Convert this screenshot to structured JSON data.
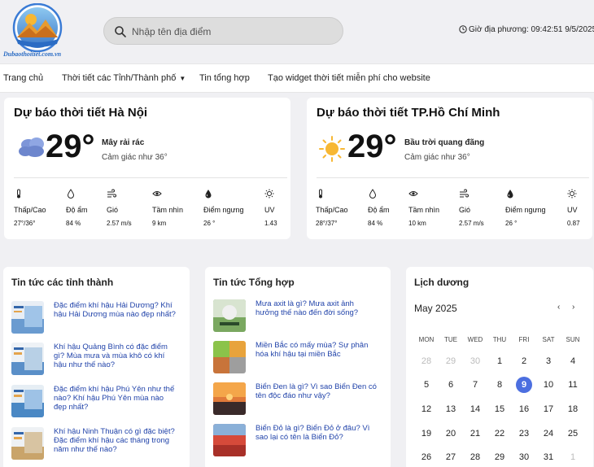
{
  "header": {
    "logo_text": "Dubaothoitiet.com.vn",
    "search_placeholder": "Nhập tên địa điểm",
    "clock_label": "Giờ địa phương: 09:42:51 9/5/2025"
  },
  "nav": {
    "items": [
      {
        "label": "Trang chủ"
      },
      {
        "label": "Thời tiết các Tỉnh/Thành phố"
      },
      {
        "label": "Tin tổng hợp"
      },
      {
        "label": "Tạo widget thời tiết miễn phí cho website"
      }
    ]
  },
  "weather": [
    {
      "title": "Dự báo thời tiết Hà Nội",
      "temp": "29°",
      "condition": "Mây rải rác",
      "feels": "Cảm giác như 36°",
      "icon": "cloud-icon",
      "stats": [
        {
          "icon": "thermometer-icon",
          "label": "Thấp/Cao",
          "value": "27°/36°"
        },
        {
          "icon": "droplet-icon",
          "label": "Độ ẩm",
          "value": "84 %"
        },
        {
          "icon": "wind-icon",
          "label": "Gió",
          "value": "2.57 m/s"
        },
        {
          "icon": "eye-icon",
          "label": "Tầm nhìn",
          "value": "9 km"
        },
        {
          "icon": "dew-icon",
          "label": "Điểm ngưng",
          "value": "26 °"
        },
        {
          "icon": "sun-uv-icon",
          "label": "UV",
          "value": "1.43"
        }
      ]
    },
    {
      "title": "Dự báo thời tiết TP.Hồ Chí Minh",
      "temp": "29°",
      "condition": "Bầu trời quang đãng",
      "feels": "Cảm giác như 36°",
      "icon": "sun-icon",
      "stats": [
        {
          "icon": "thermometer-icon",
          "label": "Thấp/Cao",
          "value": "28°/37°"
        },
        {
          "icon": "droplet-icon",
          "label": "Độ ẩm",
          "value": "84 %"
        },
        {
          "icon": "eye-icon",
          "label": "Tầm nhìn",
          "value": "10 km"
        },
        {
          "icon": "wind-icon",
          "label": "Gió",
          "value": "2.57 m/s"
        },
        {
          "icon": "dew-icon",
          "label": "Điểm ngưng",
          "value": "26 °"
        },
        {
          "icon": "sun-uv-icon",
          "label": "UV",
          "value": "0.87"
        }
      ]
    }
  ],
  "province_news": {
    "title": "Tin tức các tỉnh thành",
    "items": [
      {
        "text": "Đặc điểm khí hậu Hải Dương? Khí hậu Hải Dương mùa nào đẹp nhất?"
      },
      {
        "text": "Khí hậu Quảng Bình có đặc điểm gì? Mùa mưa và mùa khô có khí hậu như thế nào?"
      },
      {
        "text": "Đặc điểm khí hậu Phú Yên như thế nào? Khí hậu Phú Yên mùa nào đẹp nhất?"
      },
      {
        "text": "Khí hậu Ninh Thuận có gì đặc biệt? Đặc điểm khí hậu các tháng trong năm như thế nào?"
      }
    ]
  },
  "general_news": {
    "title": "Tin tức Tổng hợp",
    "items": [
      {
        "text": "Mưa axit là gì? Mưa axit ảnh hưởng thế nào đến đời sống?"
      },
      {
        "text": "Miền Bắc có mấy mùa? Sự phân hóa khí hậu tại miền Bắc"
      },
      {
        "text": "Biển Đen là gì? Vì sao Biển Đen có tên độc đáo như vậy?"
      },
      {
        "text": "Biển Đỏ là gì? Biển Đỏ ở đâu? Vì sao lại có tên là Biển Đỏ?"
      }
    ]
  },
  "calendar": {
    "title": "Lịch dương",
    "month": "May 2025",
    "prev": "‹",
    "next": "›",
    "weekdays": [
      "MON",
      "TUE",
      "WED",
      "THU",
      "FRI",
      "SAT",
      "SUN"
    ],
    "weeks": [
      [
        "28",
        "29",
        "30",
        "1",
        "2",
        "3",
        "4"
      ],
      [
        "5",
        "6",
        "7",
        "8",
        "9",
        "10",
        "11"
      ],
      [
        "12",
        "13",
        "14",
        "15",
        "16",
        "17",
        "18"
      ],
      [
        "19",
        "20",
        "21",
        "22",
        "23",
        "24",
        "25"
      ],
      [
        "26",
        "27",
        "28",
        "29",
        "30",
        "31",
        "1"
      ]
    ],
    "today": "9",
    "accent": "#4c6fe0"
  }
}
